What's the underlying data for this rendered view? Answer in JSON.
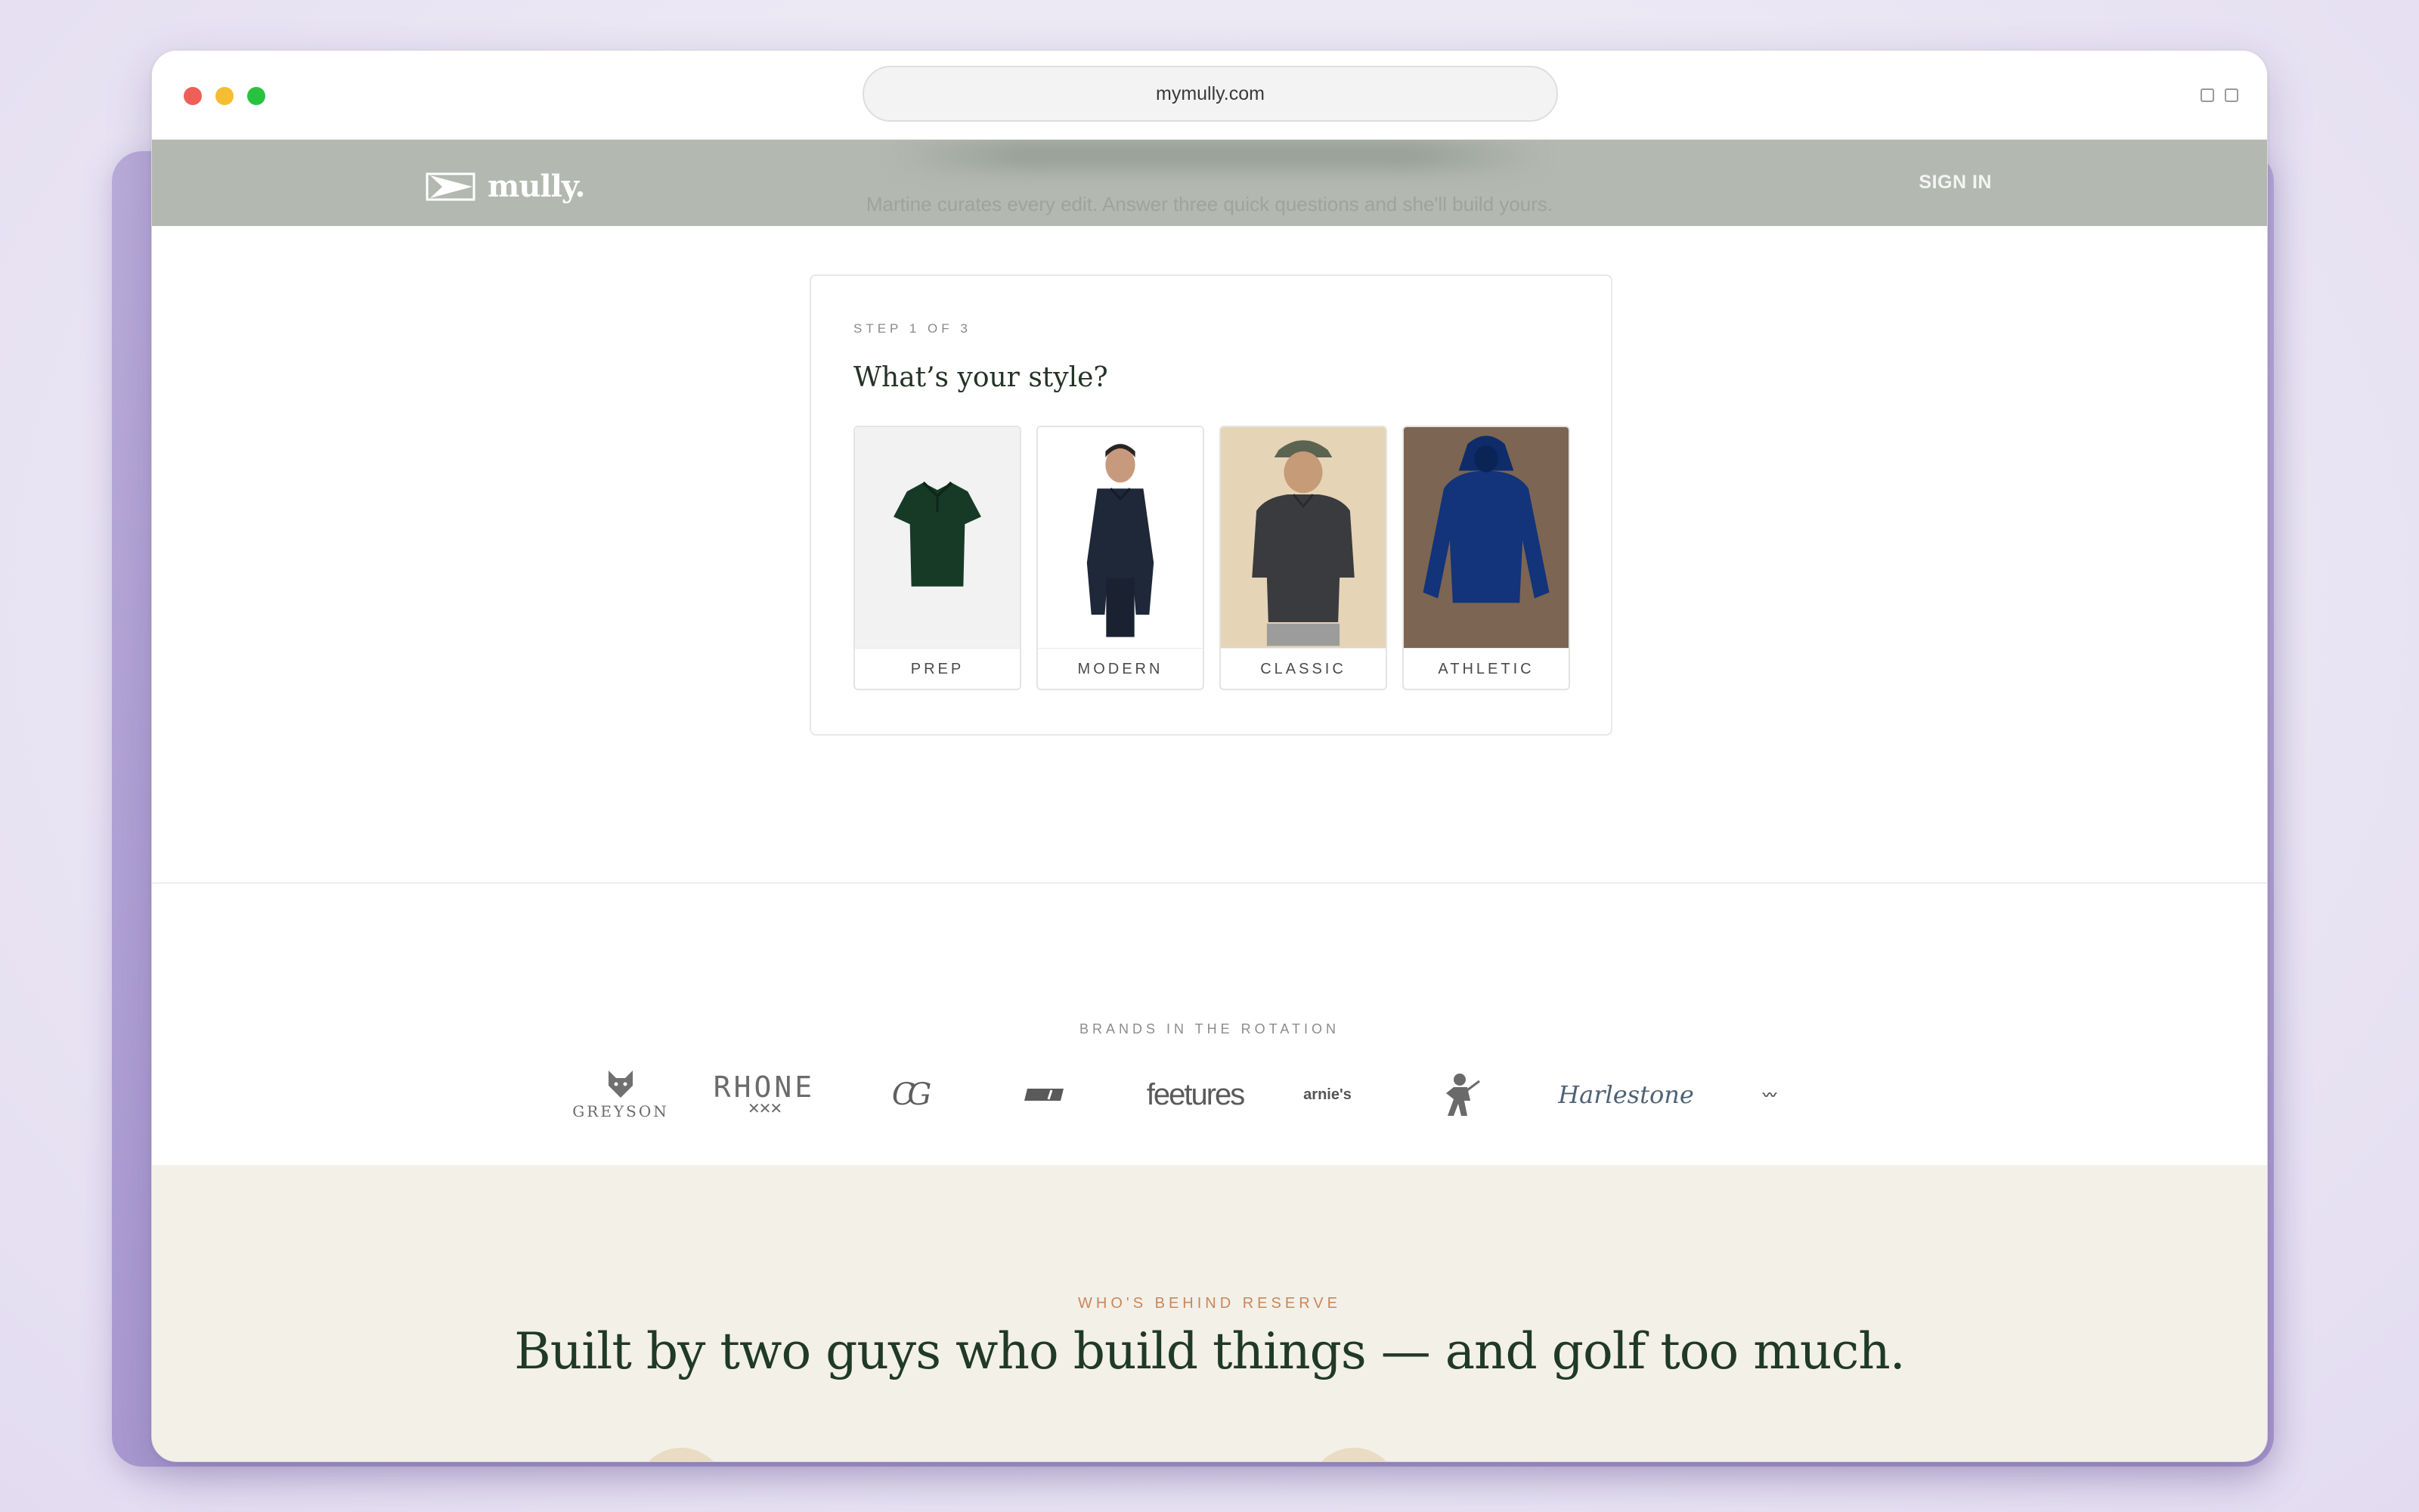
{
  "browser": {
    "url": "mymully.com",
    "traffic_lights": [
      "#ed5f57",
      "#f5bd30",
      "#29c240"
    ]
  },
  "header": {
    "logo_text": "mully.",
    "tagline": "Martine curates every edit. Answer three quick questions and she'll build yours.",
    "sign_in": "SIGN IN",
    "bg_color": "#b3b8b1"
  },
  "quiz": {
    "step": "STEP 1 OF 3",
    "question": "What’s your style?",
    "options": [
      {
        "label": "PREP",
        "icon": "green-polo-image"
      },
      {
        "label": "MODERN",
        "icon": "man-navy-pullover-image"
      },
      {
        "label": "CLASSIC",
        "icon": "man-black-polo-cap-image"
      },
      {
        "label": "ATHLETIC",
        "icon": "navy-hoodie-image"
      }
    ]
  },
  "brands": {
    "title": "BRANDS IN THE ROTATION",
    "items": [
      {
        "name": "GREYSON"
      },
      {
        "name": "RHONE"
      },
      {
        "name": "CG"
      },
      {
        "name": "brand-4"
      },
      {
        "name": "feetures"
      },
      {
        "name": "arnie's"
      },
      {
        "name": "brand-7"
      },
      {
        "name": "Harlestone"
      },
      {
        "name": "brand-9"
      }
    ]
  },
  "about": {
    "kicker": "WHO'S BEHIND RESERVE",
    "title": "Built by two guys who build things — and golf too much."
  }
}
